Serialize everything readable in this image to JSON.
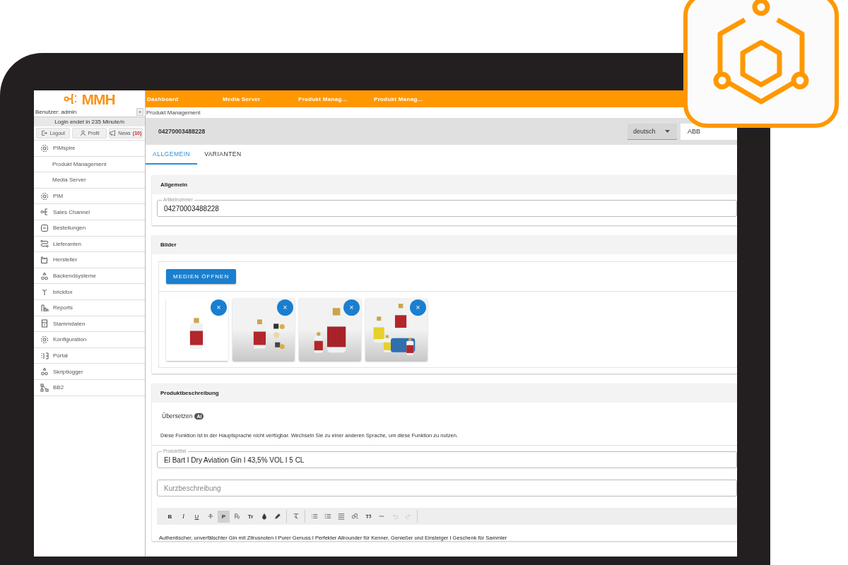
{
  "sidebar": {
    "logo": "MMH",
    "user": "Benutzer: admin",
    "collapse": "«",
    "session": "Login endet in 235 Minute/n",
    "actions": [
      {
        "label": "Logout"
      },
      {
        "label": "Profil"
      },
      {
        "label": "News",
        "count": "(10)"
      }
    ],
    "items": [
      {
        "label": "PIMspire",
        "kind": "section"
      },
      {
        "label": "Produkt Management",
        "kind": "subitem"
      },
      {
        "label": "Media Server",
        "kind": "subitem"
      },
      {
        "label": "PIM",
        "kind": "section"
      },
      {
        "label": "Sales Channel",
        "kind": "section"
      },
      {
        "label": "Bestellungen",
        "kind": "section"
      },
      {
        "label": "Lieferanten",
        "kind": "section"
      },
      {
        "label": "Hersteller",
        "kind": "section"
      },
      {
        "label": "Backendsysteme",
        "kind": "section"
      },
      {
        "label": "brickfox",
        "kind": "section"
      },
      {
        "label": "Reports",
        "kind": "section"
      },
      {
        "label": "Stammdaten",
        "kind": "section"
      },
      {
        "label": "Konfiguration",
        "kind": "section"
      },
      {
        "label": "Portal",
        "kind": "section"
      },
      {
        "label": "Skriptlogger",
        "kind": "section"
      },
      {
        "label": "BB2",
        "kind": "section"
      }
    ]
  },
  "topnav": [
    {
      "label": "Dashboard"
    },
    {
      "label": "Media Server"
    },
    {
      "label": "Produkt Manag..."
    },
    {
      "label": "Produkt Manag..."
    }
  ],
  "breadcrumb": "Produkt Management",
  "header": {
    "title": "04270003488228",
    "language": "deutsch",
    "cancel": "ABB"
  },
  "tabs": [
    {
      "label": "ALLGEMEIN",
      "selected": true
    },
    {
      "label": "VARIANTEN",
      "selected": false
    }
  ],
  "general": {
    "title": "Allgemein",
    "field": {
      "label": "Artikelnummer",
      "value": "04270003488228"
    }
  },
  "images": {
    "title": "Bilder",
    "button": "MEDIEN ÖFFNEN",
    "items": [
      {
        "kind": "picture",
        "remove": "×"
      },
      {
        "kind": "picture",
        "remove": "×"
      },
      {
        "kind": "picture",
        "remove": "×"
      },
      {
        "kind": "picture",
        "remove": "×"
      }
    ]
  },
  "description": {
    "title": "Produktbeschreibung",
    "translate": "Übersetzen",
    "badge": "AI",
    "note": "Diese Funktion ist in der Hauptsprache nicht verfügbar. Wechseln Sie zu einer anderen Sprache, um diese Funktion zu nutzen.",
    "title_field": {
      "label": "Produkttitel",
      "value": "El Bart I Dry Aviation Gin I 43,5% VOL I 5 CL"
    },
    "short_field": {
      "placeholder": "Kurzbeschreibung"
    },
    "toolbar": [
      {
        "items": [
          {
            "kind": "bold",
            "label": "B",
            "selected": false,
            "disabled": false
          },
          {
            "kind": "italic",
            "label": "I",
            "selected": false,
            "disabled": false
          },
          {
            "kind": "underline",
            "label": "U",
            "selected": false,
            "disabled": false
          },
          {
            "kind": "icon",
            "selected": false,
            "disabled": false
          },
          {
            "kind": "text",
            "label": "P",
            "selected": true,
            "disabled": false
          },
          {
            "kind": "icon",
            "selected": false,
            "disabled": false
          },
          {
            "kind": "text",
            "label": "Tr",
            "selected": false,
            "disabled": false
          },
          {
            "kind": "icon",
            "selected": false,
            "disabled": false
          },
          {
            "kind": "icon",
            "selected": false,
            "disabled": false
          }
        ]
      },
      {
        "items": [
          {
            "kind": "icon",
            "selected": false,
            "disabled": false
          }
        ]
      },
      {
        "items": [
          {
            "kind": "icon",
            "selected": false,
            "disabled": false
          },
          {
            "kind": "icon",
            "selected": false,
            "disabled": false
          },
          {
            "kind": "icon",
            "selected": false,
            "disabled": false
          },
          {
            "kind": "icon",
            "selected": false,
            "disabled": false
          },
          {
            "kind": "icon",
            "selected": false,
            "disabled": false
          },
          {
            "kind": "icon",
            "selected": false,
            "disabled": false
          },
          {
            "kind": "icon",
            "selected": false,
            "disabled": true
          },
          {
            "kind": "icon",
            "selected": false,
            "disabled": true
          }
        ]
      }
    ],
    "body": "Authentischer, unverfälschter Gin mit Zitrusnoten I Purer Genuss I Perfekter Allrounder für Kenner, Genießer und Einsteiger I Geschenk für Sammler"
  }
}
